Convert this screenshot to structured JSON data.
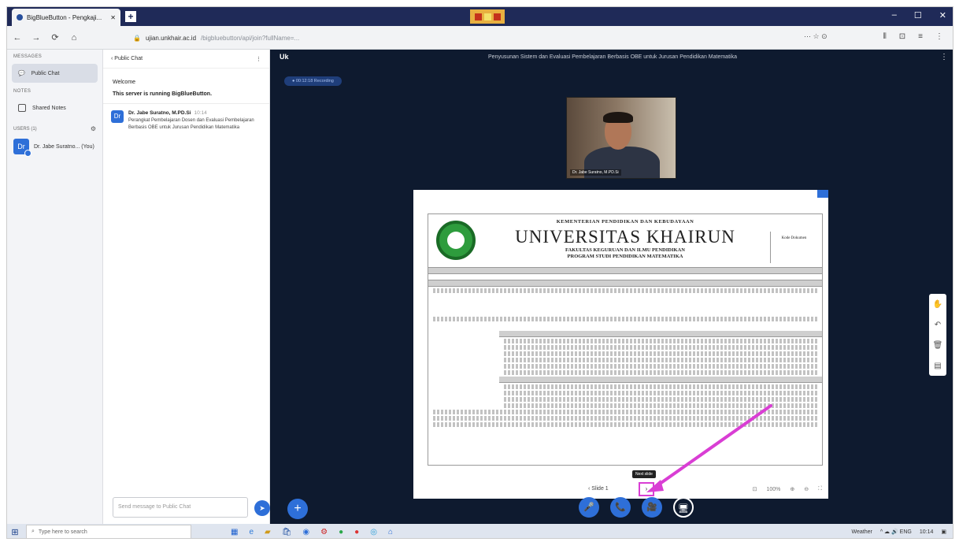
{
  "browser": {
    "tab_title": "BigBlueButton - Pengkaji...",
    "tab_close": "✕",
    "new_tab": "+",
    "url_host": "ujian.unkhair.ac.id",
    "url_path": "/bigbluebutton/api/join?fullName=...",
    "zoom": "⋯ ☆ ⊙",
    "nav_back": "←",
    "nav_forward": "→",
    "nav_reload": "⟳",
    "nav_home": "⌂",
    "win_min": "–",
    "win_max": "☐",
    "win_close": "✕",
    "right_icons": [
      "⫴",
      "⊡",
      "≡",
      "⋮"
    ]
  },
  "sidebar": {
    "messages_title": "MESSAGES",
    "public_chat": "Public Chat",
    "notes_title": "NOTES",
    "shared_notes": "Shared Notes",
    "users_title": "USERS (1)",
    "user_name": "Dr. Jabe Suratno... (You)",
    "user_initials": "Dr"
  },
  "chat": {
    "header": "‹ Public Chat",
    "menu": "⋮",
    "welcome": "Welcome",
    "welcome_sub": "This server is running BigBlueButton.",
    "msg_initials": "Dr",
    "msg_author": "Dr. Jabe Suratno, M.PD.Si",
    "msg_time": "10:14",
    "msg_text": "Perangkat Pembelajaran Dosen dan Evaluasi Pembelajaran Berbasis OBE untuk Jurusan Pendidikan Matematika",
    "input_placeholder": "Send message to Public Chat",
    "send": "➤"
  },
  "stage": {
    "title": "Penyusunan Sistem dan Evaluasi Pembelajaran Berbasis OBE untuk Jurusan Pendidikan Matematika",
    "user_badge": "Uk",
    "menu": "⋮",
    "recording": "● 00:12:18 Recording",
    "webcam_name": "Dr. Jabe Suratno, M.PD.Si",
    "tooltip": "Next slide",
    "slide_prev_label": "‹  Slide 1  ",
    "slide_next_label": "›",
    "slide_toolbar": [
      "⊡",
      "100%",
      "⊕",
      "⊖",
      "⛶"
    ],
    "plus": "+",
    "controls": [
      "🎤",
      "📞",
      "🎥",
      "🖥"
    ],
    "whiteboard": [
      "✋",
      "↶",
      "🗑",
      "▤"
    ]
  },
  "document": {
    "ministry": "KEMENTERIAN PENDIDIKAN DAN KEBUDAYAAN",
    "university": "UNIVERSITAS KHAIRUN",
    "faculty": "FAKULTAS KEGURUAN DAN ILMU PENDIDIKAN",
    "program": "PROGRAM STUDI PENDIDIKAN MATEMATIKA",
    "code_box": "Kode Dokumen"
  },
  "taskbar": {
    "start": "⊞",
    "search_icon": "⌕",
    "search_placeholder": "Type here to search",
    "apps": [
      "▦",
      "e",
      "▰",
      "🛍",
      "◉",
      "⚙",
      "●",
      "●",
      "◎",
      "⌂"
    ],
    "weather": "Weather",
    "tray_icons": "^ ☁ 🔊 ENG",
    "clock": "10:14"
  },
  "colors": {
    "stage_bg": "#0e1a2f",
    "accent": "#2e6fd8",
    "annotation": "#d93ed4"
  }
}
